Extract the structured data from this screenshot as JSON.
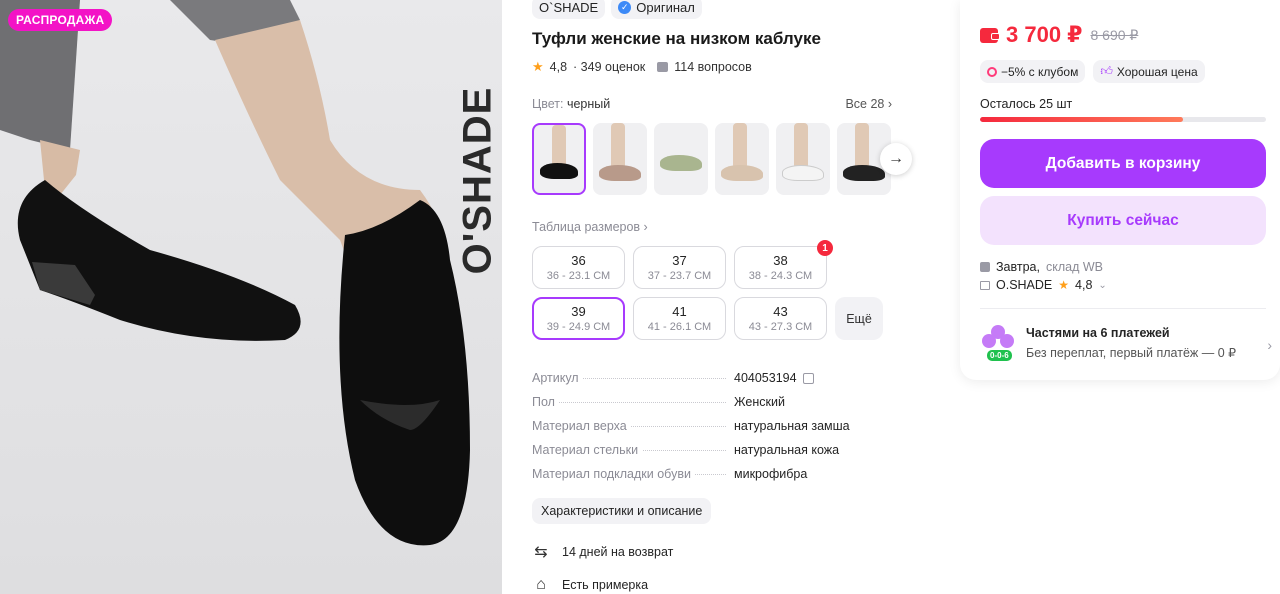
{
  "gallery": {
    "sale_badge": "РАСПРОДАЖА",
    "watermark": "O'SHADE"
  },
  "product": {
    "brand_chip": "O`SHADE",
    "original_chip": "Оригинал",
    "title": "Туфли женские на низком каблуке",
    "rating": "4,8",
    "reviews": "· 349 оценок",
    "questions": "114 вопросов",
    "color_label": "Цвет:",
    "color_value": "черный",
    "all_colors": "Все 28 ›",
    "size_table_link": "Таблица размеров ›",
    "more_sizes": "Ещё",
    "sizes": [
      {
        "size": "36",
        "cm": "36 - 23.1 СМ"
      },
      {
        "size": "37",
        "cm": "37 - 23.7 СМ"
      },
      {
        "size": "38",
        "cm": "38 - 24.3 СМ",
        "badge": "1"
      },
      {
        "size": "39",
        "cm": "39 - 24.9 СМ"
      },
      {
        "size": "41",
        "cm": "41 - 26.1 СМ"
      },
      {
        "size": "43",
        "cm": "43 - 27.3 СМ"
      }
    ],
    "specs": [
      {
        "key": "Артикул",
        "value": "404053194"
      },
      {
        "key": "Пол",
        "value": "Женский"
      },
      {
        "key": "Материал верха",
        "value": "натуральная замша"
      },
      {
        "key": "Материал стельки",
        "value": "натуральная кожа"
      },
      {
        "key": "Материал подкладки обуви",
        "value": "микрофибра"
      }
    ],
    "description_button": "Характеристики и описание",
    "return_perk": "14 дней на возврат",
    "fitting_perk": "Есть примерка"
  },
  "buy_panel": {
    "price": "3 700 ₽",
    "old_price": "8 690 ₽",
    "club_tag": "−5% с клубом",
    "good_price_tag": "Хорошая цена",
    "stock_text": "Осталось 25 шт",
    "stock_fraction": 0.71,
    "add_to_cart": "Добавить в корзину",
    "buy_now": "Купить сейчас",
    "delivery_day": "Завтра,",
    "delivery_from": "склад WB",
    "seller_name": "O.SHADE",
    "seller_rating": "4,8",
    "installments_title": "Частями на 6 платежей",
    "installments_sub": "Без переплат, первый платёж — 0 ₽",
    "installments_pill": "0-0-6"
  },
  "colors": {
    "accent": "#a73afd",
    "price_red": "#f5293d",
    "sale_pink": "#f313c6"
  }
}
